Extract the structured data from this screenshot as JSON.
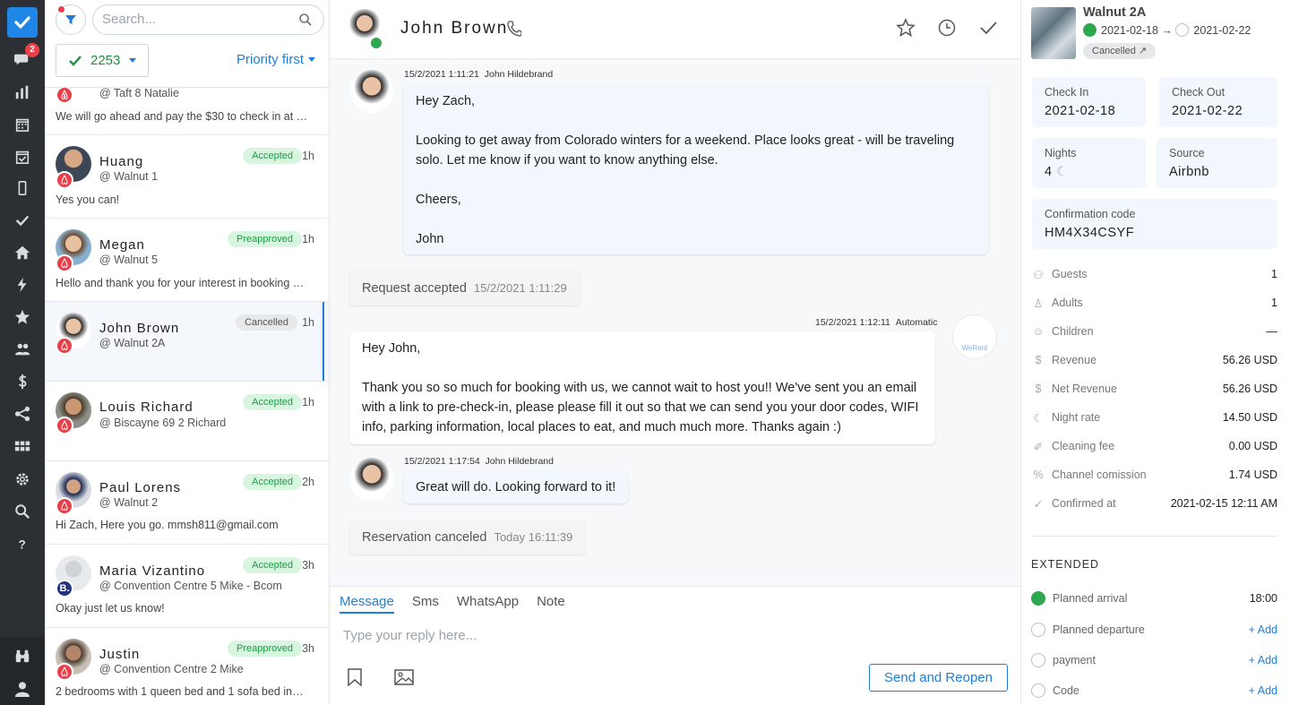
{
  "rail": {
    "unread_badge": "2",
    "icons": [
      "chat-icon",
      "bar-chart-icon",
      "calendar-icon",
      "calendar-check-icon",
      "phone-icon",
      "check-icon",
      "home-icon",
      "bolt-icon",
      "star-icon",
      "users-icon",
      "dollar-icon",
      "share-icon",
      "apps-icon",
      "gear-icon",
      "search-icon",
      "help-icon"
    ]
  },
  "list": {
    "search_placeholder": "Search...",
    "count": "2253",
    "sort": "Priority first",
    "conversations": [
      {
        "name": "",
        "property": "@ Taft 8 Natalie",
        "preview": "We will go ahead and pay the $30 to check in at 1...",
        "status": "",
        "time": "",
        "source": "airbnb"
      },
      {
        "name": "Huang",
        "property": "@ Walnut 1",
        "preview": "Yes you can!",
        "status": "Accepted",
        "time": "1h",
        "source": "airbnb"
      },
      {
        "name": "Megan",
        "property": "@ Walnut 5",
        "preview": "Hello and thank you for your interest in booking wi...",
        "status": "Preapproved",
        "time": "1h",
        "source": "airbnb"
      },
      {
        "name": "John Brown",
        "property": "@ Walnut 2A",
        "preview": "",
        "status": "Cancelled",
        "time": "1h",
        "source": "airbnb"
      },
      {
        "name": "Louis Richard",
        "property": "@ Biscayne 69 2 Richard",
        "preview": "",
        "status": "Accepted",
        "time": "1h",
        "source": "airbnb"
      },
      {
        "name": "Paul Lorens",
        "property": "@ Walnut 2",
        "preview": "Hi Zach, Here you go. mmsh811@gmail.com",
        "status": "Accepted",
        "time": "2h",
        "source": "airbnb"
      },
      {
        "name": "Maria Vizantino",
        "property": "@ Convention Centre 5 Mike - Bcom",
        "preview": "Okay just let us know!",
        "status": "Accepted",
        "time": "3h",
        "source": "booking",
        "source_letter": "B."
      },
      {
        "name": "Justin",
        "property": "@ Convention Centre 2 Mike",
        "preview": "2 bedrooms with 1 queen bed and 1 sofa bed insi...",
        "status": "Preapproved",
        "time": "3h",
        "source": "airbnb"
      }
    ]
  },
  "chat": {
    "guest_name": "John Brown",
    "messages": {
      "m1": {
        "meta_time": "15/2/2021 1:11:21",
        "meta_author": "John Hildebrand",
        "lines": [
          "Hey Zach,",
          "Looking to get away from Colorado winters for a weekend. Place looks great - will be traveling solo. Let me know if you want to know anything else.",
          "Cheers,",
          "John"
        ]
      },
      "s1": {
        "text": "Request accepted",
        "time": "15/2/2021 1:11:29"
      },
      "m2": {
        "meta_time": "15/2/2021 1:12:11",
        "meta_author": "Automatic",
        "lines": [
          "Hey John,",
          "Thank you so so much for booking with us, we cannot wait to host you!! We've sent you an email with a link to pre-check-in, please please fill it out so that we can send you your door codes, WIFI info, parking information, local places to eat, and much much more. Thanks again :)"
        ]
      },
      "bot_label": "WeRent",
      "m3": {
        "meta_time": "15/2/2021 1:17:54",
        "meta_author": "John Hildebrand",
        "text": "Great will do. Looking forward to it!"
      },
      "s2": {
        "text": "Reservation canceled",
        "time": "Today 16:11:39"
      }
    },
    "compose": {
      "tabs": [
        "Message",
        "Sms",
        "WhatsApp",
        "Note"
      ],
      "placeholder": "Type your reply here...",
      "send_label": "Send and Reopen"
    }
  },
  "panel": {
    "property": "Walnut 2A",
    "date_from": "2021-02-18",
    "arrow": "→",
    "date_to": "2021-02-22",
    "status_badge": "Cancelled ↗",
    "check_in_label": "Check In",
    "check_in": "2021-02-18",
    "check_out_label": "Check Out",
    "check_out": "2021-02-22",
    "nights_label": "Nights",
    "nights": "4",
    "source_label": "Source",
    "source": "Airbnb",
    "conf_label": "Confirmation code",
    "conf_code": "HM4X34CSYF",
    "details": [
      {
        "label": "Guests",
        "value": "1",
        "icon": "guests-icon"
      },
      {
        "label": "Adults",
        "value": "1",
        "icon": "adult-icon"
      },
      {
        "label": "Children",
        "value": "—",
        "icon": "children-icon"
      },
      {
        "label": "Revenue",
        "value": "56.26 USD",
        "icon": "dollar-icon"
      },
      {
        "label": "Net Revenue",
        "value": "56.26 USD",
        "icon": "dollar-icon"
      },
      {
        "label": "Night rate",
        "value": "14.50 USD",
        "icon": "moon-icon"
      },
      {
        "label": "Cleaning fee",
        "value": "0.00 USD",
        "icon": "broom-icon"
      },
      {
        "label": "Channel comission",
        "value": "1.74 USD",
        "icon": "percent-icon"
      },
      {
        "label": "Confirmed at",
        "value": "2021-02-15 12:11 AM",
        "icon": "check-icon"
      }
    ],
    "extended_title": "EXTENDED",
    "extended": [
      {
        "label": "Planned arrival",
        "value": "18:00",
        "done": true
      },
      {
        "label": "Planned departure",
        "value": "+ Add",
        "done": false
      },
      {
        "label": "payment",
        "value": "+ Add",
        "done": false
      },
      {
        "label": "Code",
        "value": "+ Add",
        "done": false
      }
    ]
  },
  "colors": {
    "accent": "#1f7fd6",
    "rail": "#2c3034",
    "success": "#2ea84f",
    "danger": "#e8404a"
  }
}
